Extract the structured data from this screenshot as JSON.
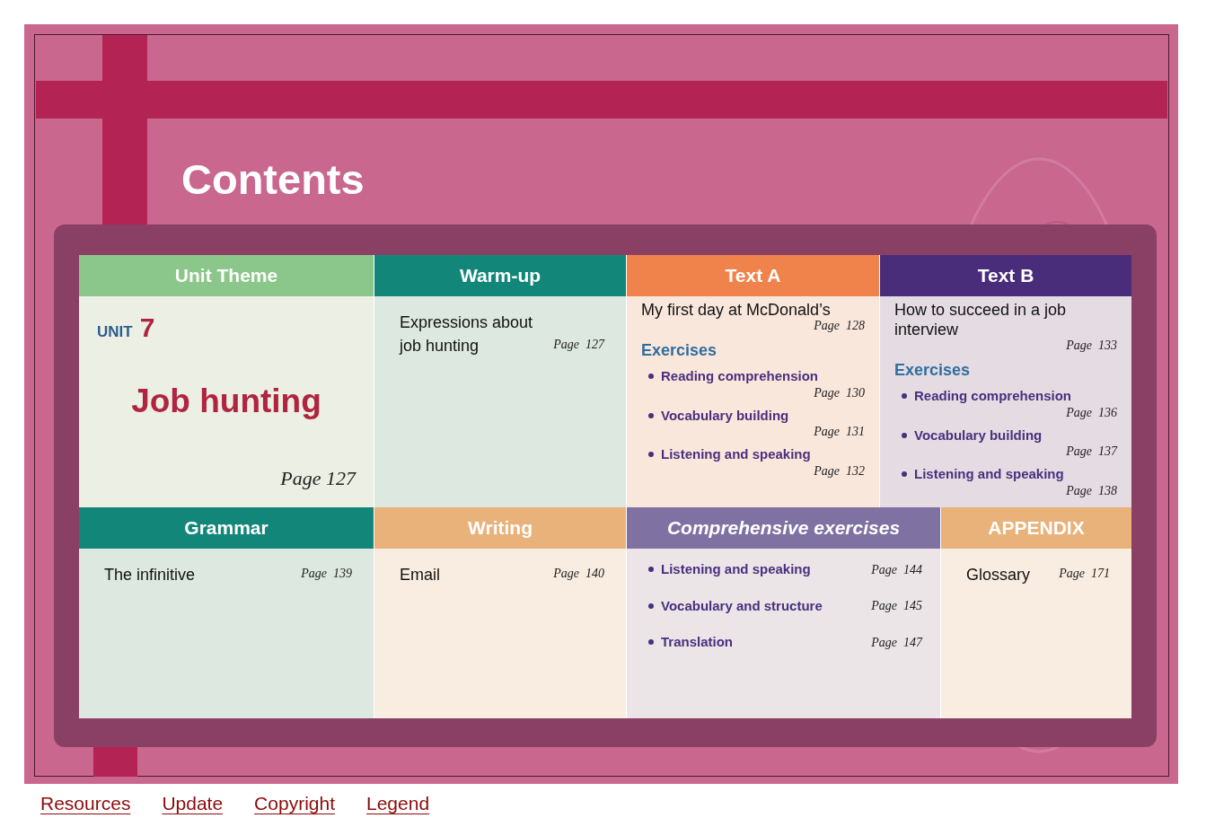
{
  "title": "Contents",
  "rows": [
    [
      {
        "kind": "theme",
        "header": "Unit Theme",
        "color": "#8bc68a",
        "italic": false,
        "unit_label": "UNIT",
        "unit_number": "7",
        "theme": "Job hunting",
        "page": "Page 127"
      },
      {
        "kind": "entry",
        "header": "Warm-up",
        "color": "#128779",
        "italic": false,
        "entry": "Expressions about job hunting",
        "page": "Page  127"
      },
      {
        "kind": "text",
        "header": "Text A",
        "color": "#f0834b",
        "italic": false,
        "entry": "My first day at McDonald’s",
        "page": "Page  128",
        "exercises_label": "Exercises",
        "exercises": [
          {
            "name": "Reading comprehension",
            "page": "Page  130"
          },
          {
            "name": "Vocabulary building",
            "page": "Page  131"
          },
          {
            "name": "Listening and speaking",
            "page": "Page  132"
          }
        ]
      },
      {
        "kind": "text",
        "header": "Text B",
        "color": "#4a2d7a",
        "italic": false,
        "entry": "How to succeed in a job interview",
        "page": "Page  133",
        "exercises_label": "Exercises",
        "exercises": [
          {
            "name": "Reading comprehension",
            "page": "Page  136"
          },
          {
            "name": "Vocabulary building",
            "page": "Page  137"
          },
          {
            "name": "Listening and speaking",
            "page": "Page  138"
          }
        ]
      }
    ],
    [
      {
        "kind": "entry",
        "header": "Grammar",
        "color": "#128779",
        "italic": false,
        "entry": "The infinitive",
        "page": "Page  139"
      },
      {
        "kind": "entry",
        "header": "Writing",
        "color": "#e8b27a",
        "italic": false,
        "entry": "Email",
        "page": "Page  140"
      },
      {
        "kind": "list",
        "header": "Comprehensive exercises",
        "color": "#7f71a1",
        "italic": true,
        "items": [
          {
            "name": "Listening and speaking",
            "page": "Page  144"
          },
          {
            "name": "Vocabulary and structure",
            "page": "Page  145"
          },
          {
            "name": "Translation",
            "page": "Page  147"
          }
        ]
      },
      {
        "kind": "entry",
        "header": "APPENDIX",
        "color": "#e8b27a",
        "italic": false,
        "entry": "Glossary",
        "page": "Page  171"
      }
    ]
  ],
  "footer_links": [
    "Resources",
    "Update",
    "Copyright",
    "Legend"
  ]
}
